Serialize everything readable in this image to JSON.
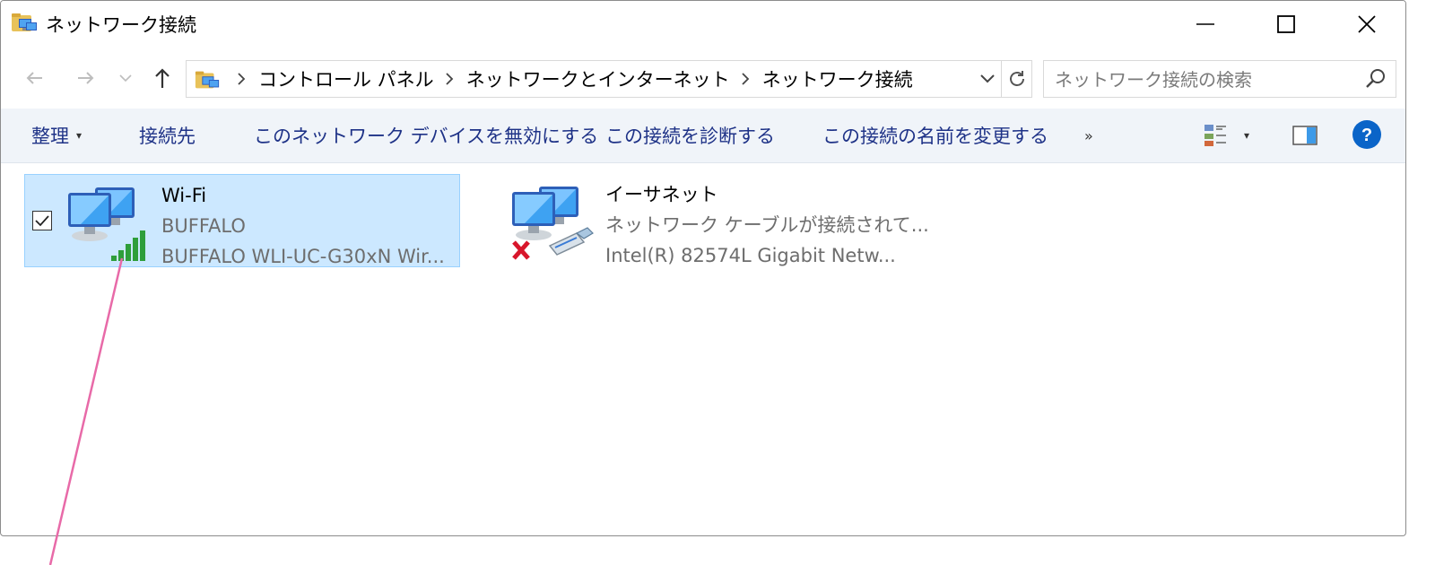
{
  "window": {
    "title": "ネットワーク接続"
  },
  "nav": {
    "breadcrumbs": [
      "コントロール パネル",
      "ネットワークとインターネット",
      "ネットワーク接続"
    ]
  },
  "search": {
    "placeholder": "ネットワーク接続の検索"
  },
  "commands": {
    "organize": "整理",
    "connect_to": "接続先",
    "disable_device": "このネットワーク デバイスを無効にする",
    "diagnose": "この接続を診断する",
    "rename": "この接続の名前を変更する",
    "more": "»"
  },
  "connections": [
    {
      "name": "Wi-Fi",
      "network": "BUFFALO",
      "adapter": "BUFFALO WLI-UC-G30xN Wir...",
      "selected": true,
      "signal_bars": 5
    },
    {
      "name": "イーサネット",
      "network": "ネットワーク ケーブルが接続されて...",
      "adapter": "Intel(R) 82574L Gigabit Netw...",
      "selected": false,
      "status": "disconnected"
    }
  ],
  "colors": {
    "selection_bg": "#cce8ff",
    "selection_border": "#99d1ff",
    "commandbar_bg": "#f0f4f9",
    "command_text": "#1e3287",
    "help_blue": "#0a64c8",
    "annotation_line": "#e86aa8",
    "disconnected_x": "#d8162b",
    "signal_green": "#2e9e3a"
  }
}
